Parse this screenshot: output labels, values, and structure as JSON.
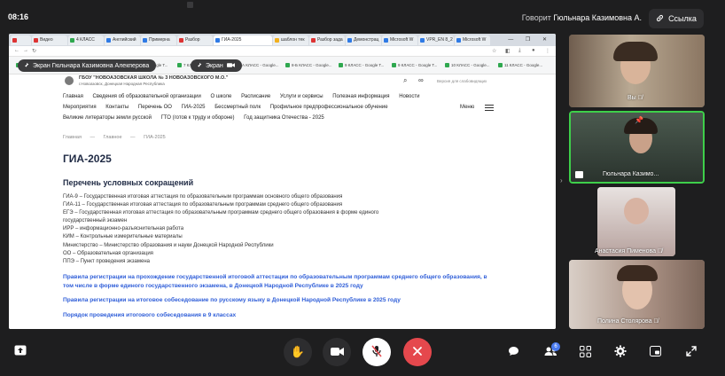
{
  "topbar": {
    "time": "08:16",
    "speaker_label": "Говорит",
    "speaker_name": "Гюльнара Казимовна А.",
    "link_label": "Ссылка"
  },
  "browser": {
    "tabs": [
      "Видео",
      "4 КЛАСС",
      "Английский",
      "Примерна",
      "Разбор",
      "ГИА-2025",
      "шаблон тек",
      "Разбор зада",
      "Демонстрац",
      "Microsoft W",
      "VPR_EN 8_2",
      "Microsoft W"
    ],
    "active_tab": "ГИА-2025",
    "window_controls": "— ❐ ✕",
    "bookmarks": [
      "4 КЛАСС - Google T...",
      "5 класс - Google T...",
      "6 КЛАСС - Google T...",
      "7 КЛАСС - Google T...",
      "8-А КЛАСС - Google...",
      "8-Б КЛАСС - Google...",
      "9 КЛАСС - Google T...",
      "9 КЛАСС - Google T...",
      "10 КЛАСС - Google...",
      "11 КЛАСС - Google..."
    ],
    "share_pill_1": "Экран Гюльнара Казимовна Алекперова",
    "share_pill_2": "Экран"
  },
  "site": {
    "school_name": "ГБОУ \"НОВОАЗОВСКАЯ ШКОЛА № 3 НОВОАЗОВСКОГО М.О.\"",
    "school_sub": "г.Новоазовск, Донецкая Народная Республика",
    "version_label": "Версия для слабовидящих",
    "nav_row1": [
      "Главная",
      "Сведения об образовательной организации",
      "О школе",
      "Расписание",
      "Услуги и сервисы",
      "Полезная информация",
      "Новости"
    ],
    "nav_row2": [
      "Мероприятия",
      "Контакты",
      "Перечень ОО",
      "ГИА-2025",
      "Бессмертный полк",
      "Профильное предпрофессиональное обучение"
    ],
    "nav_row3": [
      "Великие литераторы земли русской",
      "ГТО (готов к труду и обороне)",
      "Год защитника Отечества - 2025"
    ],
    "menu_label": "Меню",
    "breadcrumb": [
      "Главная",
      "Главное",
      "ГИА-2025"
    ],
    "title": "ГИА-2025",
    "subtitle": "Перечень условных сокращений",
    "abbreviations": [
      "ГИА-9 – Государственная итоговая аттестация по образовательным программам основного общего образования",
      "ГИА-11 – Государственная итоговая аттестация по образовательным программам среднего общего образования",
      "ЕГЭ – Государственная итоговая аттестация по образовательным программам среднего общего образования в форме единого",
      "государственный экзамен",
      "ИРР – информационно-разъяснительная работа",
      "КИМ – Контрольные измерительные материалы",
      "Министерство – Министерство образования и науки Донецкой Народной Республики",
      "ОО – Образовательная организация",
      "ППЭ – Пункт проведения экзамена"
    ],
    "links": [
      "Правила регистрации на прохождение государственной итоговой аттестации по образовательным программам среднего общего образования, в том числе в форме единого государственного экзамена, в Донецкой Народной Республике в 2025 году",
      "Правила регистрации на итоговое собеседование по русскому языку в Донецкой Народной Республике в 2025 году",
      "Порядок проведения итогового собеседования в 9 классах"
    ]
  },
  "participants": [
    {
      "name": "Вы"
    },
    {
      "name": "Гюльнара Казимо..."
    },
    {
      "name": "Анастасия Пименова"
    },
    {
      "name": "Полина Столярова"
    }
  ],
  "toolbar": {
    "participants_badge": "6"
  },
  "colors": {
    "app_bg": "#1e1e1f",
    "end_call": "#e5484d",
    "active_speaker_border": "#3ecf4a",
    "link_blue": "#2f5ed8"
  }
}
